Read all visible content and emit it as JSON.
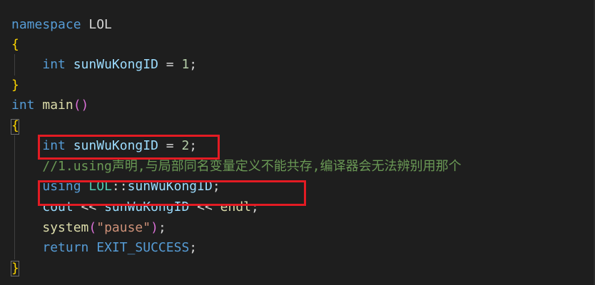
{
  "code": {
    "l1": {
      "kw": "namespace",
      "name": " LOL"
    },
    "l2": {
      "brace": "{"
    },
    "l3": {
      "type": "int",
      "var": "sunWuKongID",
      "op": " = ",
      "num": "1",
      "end": ";"
    },
    "l4": {
      "brace": "}"
    },
    "l5": {
      "type": "int",
      "fn": "main",
      "paren": "()"
    },
    "l6": {
      "brace": "{"
    },
    "l7": {
      "type": "int",
      "var": "sunWuKongID",
      "op": " = ",
      "num": "2",
      "end": ";"
    },
    "l8": {
      "comment": "//1.using声明,与局部同名变量定义不能共存,编译器会无法辨别用那个"
    },
    "l9": {
      "kw": "using",
      "ns": "LOL",
      "sep": "::",
      "var": "sunWuKongID",
      "end": ";"
    },
    "l10": {
      "a": "cout",
      "op1": " << ",
      "var": "sunWuKongID",
      "op2": " << ",
      "b": "endl",
      "end": ";"
    },
    "l11": {
      "fn": "system",
      "p1": "(",
      "str": "\"pause\"",
      "p2": ")",
      "end": ";"
    },
    "l12": {
      "kw": "return",
      "macro": "EXIT_SUCCESS",
      "end": ";"
    },
    "l13": {
      "brace": "}"
    }
  },
  "colors": {
    "background": "#1e1e1e",
    "keyword": "#569cd6",
    "variable": "#9cdcfe",
    "number": "#b5cea8",
    "string": "#ce9178",
    "function": "#dcdcaa",
    "comment": "#6a9955",
    "brace": "#ffd700",
    "highlight_box": "#e31b23"
  }
}
